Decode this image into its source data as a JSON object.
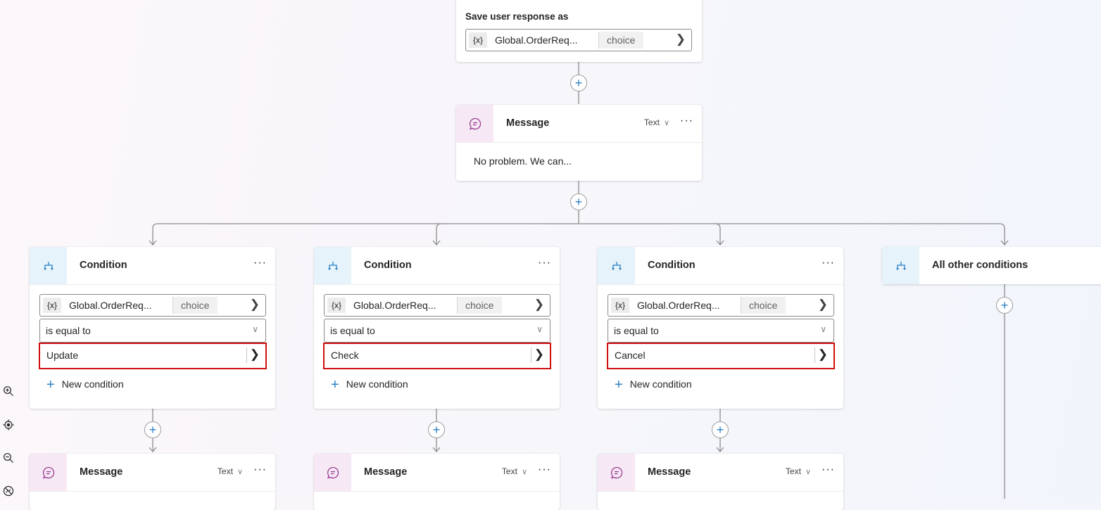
{
  "save_response": {
    "label": "Save user response as",
    "var_badge": "{x}",
    "var_name": "Global.OrderReq...",
    "var_type": "choice"
  },
  "top_message": {
    "title": "Message",
    "type": "Text",
    "body": "No problem. We can..."
  },
  "conditions": [
    {
      "title": "Condition",
      "var_badge": "{x}",
      "var_name": "Global.OrderReq...",
      "var_type": "choice",
      "operator": "is equal to",
      "value": "Update",
      "new_condition": "New condition",
      "message_title": "Message",
      "message_type": "Text"
    },
    {
      "title": "Condition",
      "var_badge": "{x}",
      "var_name": "Global.OrderReq...",
      "var_type": "choice",
      "operator": "is equal to",
      "value": "Check",
      "new_condition": "New condition",
      "message_title": "Message",
      "message_type": "Text"
    },
    {
      "title": "Condition",
      "var_badge": "{x}",
      "var_name": "Global.OrderReq...",
      "var_type": "choice",
      "operator": "is equal to",
      "value": "Cancel",
      "new_condition": "New condition",
      "message_title": "Message",
      "message_type": "Text"
    }
  ],
  "all_other": {
    "title": "All other conditions"
  },
  "icons": {
    "more": "more-icon",
    "add": "add-icon",
    "condition": "branch-icon",
    "message": "chat-bubble-icon",
    "zoom_in": "zoom-in-icon",
    "recenter": "target-icon",
    "zoom_out": "zoom-out-icon",
    "minimap": "no-map-icon"
  },
  "colors": {
    "accent": "#2b7fc4",
    "highlight": "#d10f0f",
    "condition_icon_bg": "#e6f3fb",
    "message_icon_bg": "#f6e9f5"
  }
}
